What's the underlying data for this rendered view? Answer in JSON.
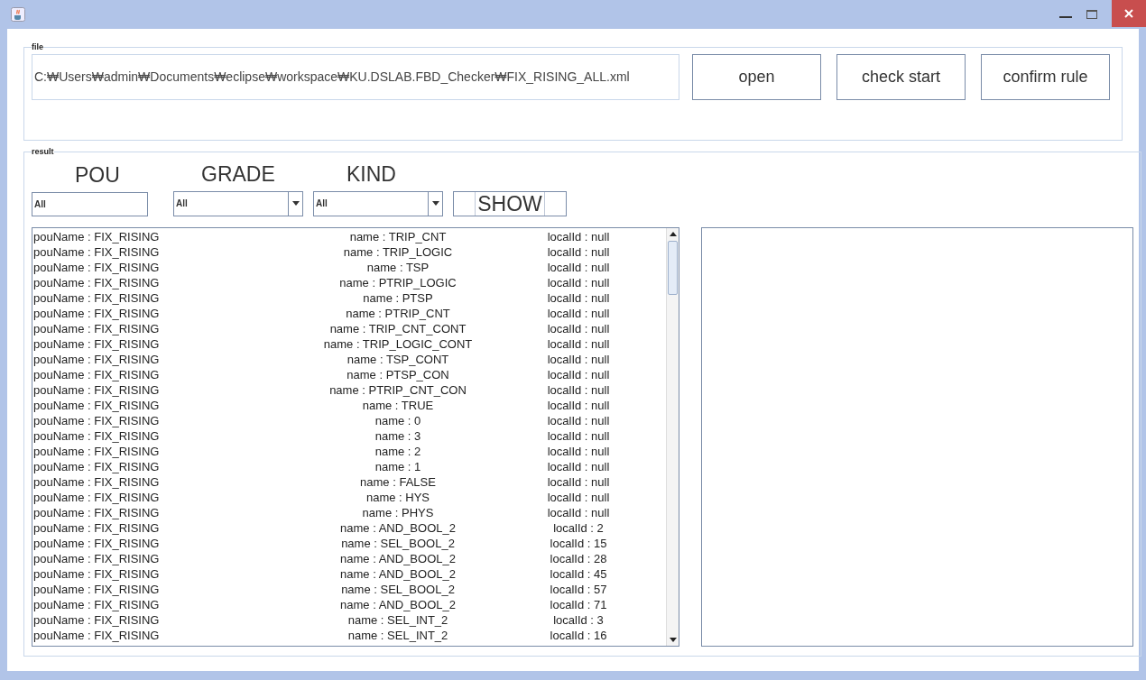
{
  "file_panel": {
    "legend": "file",
    "path": "C:₩Users₩admin₩Documents₩eclipse₩workspace₩KU.DSLAB.FBD_Checker₩FIX_RISING_ALL.xml",
    "buttons": [
      "open",
      "check start",
      "confirm rule"
    ]
  },
  "result_panel": {
    "legend": "result",
    "filters": [
      {
        "label": "POU",
        "kind": "text",
        "value": "All"
      },
      {
        "label": "GRADE",
        "kind": "dropdown",
        "value": "All"
      },
      {
        "label": "KIND",
        "kind": "dropdown",
        "value": "All"
      }
    ],
    "show_button": "SHOW",
    "rows": [
      {
        "pou": "pouName : FIX_RISING",
        "name": "name : TRIP_CNT",
        "local_id": "localId : null"
      },
      {
        "pou": "pouName : FIX_RISING",
        "name": "name : TRIP_LOGIC",
        "local_id": "localId : null"
      },
      {
        "pou": "pouName : FIX_RISING",
        "name": "name : TSP",
        "local_id": "localId : null"
      },
      {
        "pou": "pouName : FIX_RISING",
        "name": "name : PTRIP_LOGIC",
        "local_id": "localId : null"
      },
      {
        "pou": "pouName : FIX_RISING",
        "name": "name : PTSP",
        "local_id": "localId : null"
      },
      {
        "pou": "pouName : FIX_RISING",
        "name": "name : PTRIP_CNT",
        "local_id": "localId : null"
      },
      {
        "pou": "pouName : FIX_RISING",
        "name": "name : TRIP_CNT_CONT",
        "local_id": "localId : null"
      },
      {
        "pou": "pouName : FIX_RISING",
        "name": "name : TRIP_LOGIC_CONT",
        "local_id": "localId : null"
      },
      {
        "pou": "pouName : FIX_RISING",
        "name": "name : TSP_CONT",
        "local_id": "localId : null"
      },
      {
        "pou": "pouName : FIX_RISING",
        "name": "name : PTSP_CON",
        "local_id": "localId : null"
      },
      {
        "pou": "pouName : FIX_RISING",
        "name": "name : PTRIP_CNT_CON",
        "local_id": "localId : null"
      },
      {
        "pou": "pouName : FIX_RISING",
        "name": "name : TRUE",
        "local_id": "localId : null"
      },
      {
        "pou": "pouName : FIX_RISING",
        "name": "name : 0",
        "local_id": "localId : null"
      },
      {
        "pou": "pouName : FIX_RISING",
        "name": "name : 3",
        "local_id": "localId : null"
      },
      {
        "pou": "pouName : FIX_RISING",
        "name": "name : 2",
        "local_id": "localId : null"
      },
      {
        "pou": "pouName : FIX_RISING",
        "name": "name : 1",
        "local_id": "localId : null"
      },
      {
        "pou": "pouName : FIX_RISING",
        "name": "name : FALSE",
        "local_id": "localId : null"
      },
      {
        "pou": "pouName : FIX_RISING",
        "name": "name : HYS",
        "local_id": "localId : null"
      },
      {
        "pou": "pouName : FIX_RISING",
        "name": "name : PHYS",
        "local_id": "localId : null"
      },
      {
        "pou": "pouName : FIX_RISING",
        "name": "name : AND_BOOL_2",
        "local_id": "localId : 2"
      },
      {
        "pou": "pouName : FIX_RISING",
        "name": "name : SEL_BOOL_2",
        "local_id": "localId : 15"
      },
      {
        "pou": "pouName : FIX_RISING",
        "name": "name : AND_BOOL_2",
        "local_id": "localId : 28"
      },
      {
        "pou": "pouName : FIX_RISING",
        "name": "name : AND_BOOL_2",
        "local_id": "localId : 45"
      },
      {
        "pou": "pouName : FIX_RISING",
        "name": "name : SEL_BOOL_2",
        "local_id": "localId : 57"
      },
      {
        "pou": "pouName : FIX_RISING",
        "name": "name : AND_BOOL_2",
        "local_id": "localId : 71"
      },
      {
        "pou": "pouName : FIX_RISING",
        "name": "name : SEL_INT_2",
        "local_id": "localId : 3"
      },
      {
        "pou": "pouName : FIX_RISING",
        "name": "name : SEL_INT_2",
        "local_id": "localId : 16"
      }
    ]
  }
}
